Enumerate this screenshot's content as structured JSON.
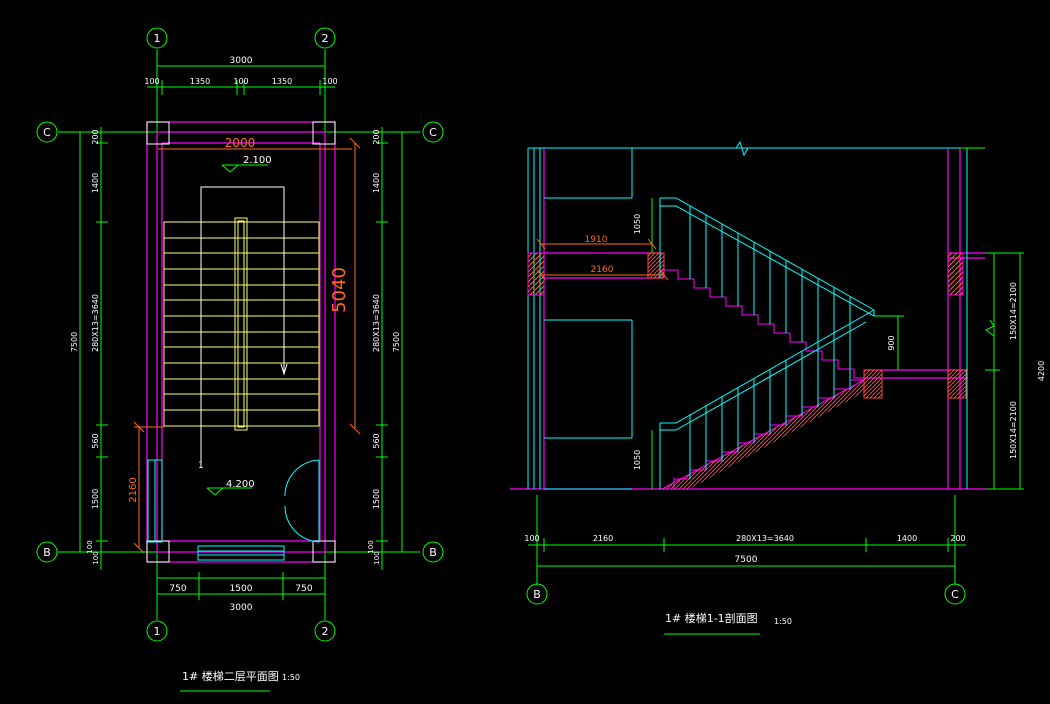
{
  "plan": {
    "axis_top_left": "1",
    "axis_top_right": "2",
    "axis_bottom_left": "1",
    "axis_bottom_right": "2",
    "axis_c_left": "C",
    "axis_c_right": "C",
    "axis_b_left": "B",
    "axis_b_right": "B",
    "dim_top_total": "3000",
    "dim_top_100a": "100",
    "dim_top_1350a": "1350",
    "dim_top_100b": "100",
    "dim_top_1350b": "1350",
    "dim_top_100c": "100",
    "dim_2000": "2000",
    "level_upper": "2.100",
    "dim_5040": "5040",
    "level_lower": "4.200",
    "dim_2160": "2160",
    "dim_left_200": "200",
    "dim_left_1400": "1400",
    "dim_left_3640": "280X13=3640",
    "dim_left_560": "560",
    "dim_left_1500": "1500",
    "dim_left_100a": "100",
    "dim_left_100b": "100",
    "dim_left_total": "7500",
    "dim_right_200": "200",
    "dim_right_1400": "1400",
    "dim_right_3640": "280X13=3640",
    "dim_right_560": "560",
    "dim_right_1500": "1500",
    "dim_right_100a": "100",
    "dim_right_100b": "100",
    "dim_right_total": "7500",
    "dim_bot_750a": "750",
    "dim_bot_1500": "1500",
    "dim_bot_750b": "750",
    "dim_bot_total": "3000",
    "title": "1# 楼梯二层平面图",
    "scale": "1:50"
  },
  "section": {
    "dim_1910": "1910",
    "dim_2160": "2160",
    "dim_1050a": "1050",
    "dim_1050b": "1050",
    "dim_900": "900",
    "dim_r_upper": "150X14=2100",
    "dim_r_total": "4200",
    "dim_r_lower": "150X14=2100",
    "dim_b_100": "100",
    "dim_b_2160": "2160",
    "dim_b_3640": "280X13=3640",
    "dim_b_1400": "1400",
    "dim_b_200": "200",
    "dim_b_total": "7500",
    "axis_b": "B",
    "axis_c": "C",
    "title": "1# 楼梯1-1剖面图",
    "scale": "1:50"
  },
  "colors": {
    "background": "#000000",
    "dimension": "#00ff00",
    "wall": "#ff00ff",
    "stair": "#ffff66",
    "rail": "#00ffff",
    "text": "#ffffff",
    "accent_dim": "#ff6a1a"
  }
}
